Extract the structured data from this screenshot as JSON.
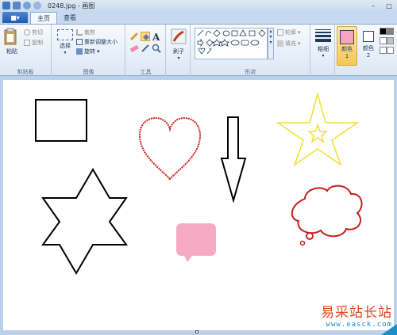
{
  "window": {
    "title": "0248.jpg - 画图"
  },
  "tabs": [
    "主页",
    "查看"
  ],
  "ribbon": {
    "clipboard": {
      "paste": "粘贴",
      "cut": "剪切",
      "copy": "复制",
      "group": "剪贴板"
    },
    "image": {
      "select": "选择",
      "crop": "裁剪",
      "resize": "重新调整大小",
      "rotate": "旋转",
      "group": "图像"
    },
    "tools": {
      "group": "工具"
    },
    "brushes": {
      "label": "刷子"
    },
    "shapes": {
      "outline": "轮廓",
      "fill": "填充",
      "group": "形状"
    },
    "size": {
      "label": "粗细"
    },
    "color1": {
      "label": "颜色 1"
    },
    "color2": {
      "label": "颜色 2"
    }
  },
  "colors": {
    "color1": "#f4a6c0",
    "color2": "#ffffff",
    "heart": "#d02020",
    "star_yellow": "#f0e030",
    "bubble": "#f6aac4",
    "cloud": "#c82020"
  },
  "watermark": {
    "site_name": "易采站长站",
    "url": "www.easck.com"
  }
}
